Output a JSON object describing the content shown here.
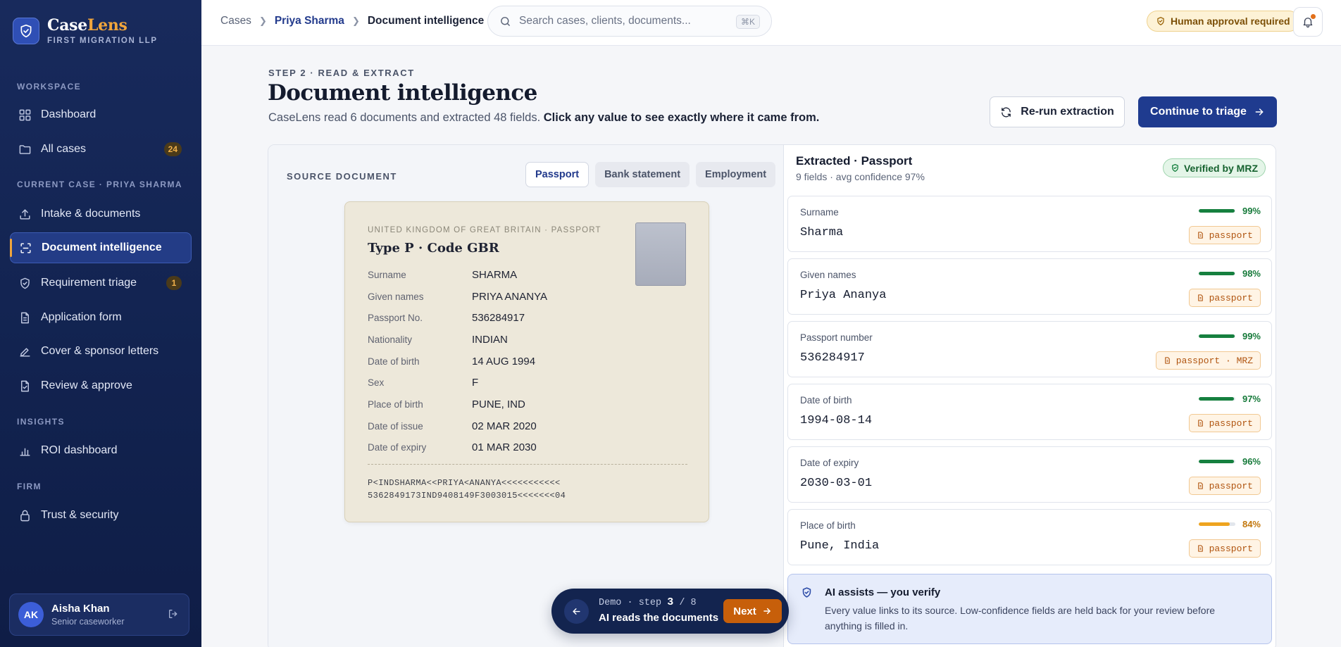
{
  "brand": {
    "name_part1": "Case",
    "name_part2": "Lens",
    "firm": "FIRST MIGRATION LLP"
  },
  "sidebar": {
    "workspace_label": "WORKSPACE",
    "workspace_items": [
      {
        "label": "Dashboard",
        "icon": "grid-icon"
      },
      {
        "label": "All cases",
        "icon": "folder-icon",
        "badge": "24"
      }
    ],
    "case_label": "CURRENT CASE · PRIYA SHARMA",
    "case_items": [
      {
        "label": "Intake & documents",
        "icon": "upload-icon"
      },
      {
        "label": "Document intelligence",
        "icon": "scan-icon",
        "active": true
      },
      {
        "label": "Requirement triage",
        "icon": "shield-check-icon",
        "badge": "1"
      },
      {
        "label": "Application form",
        "icon": "document-icon"
      },
      {
        "label": "Cover & sponsor letters",
        "icon": "pen-icon"
      },
      {
        "label": "Review & approve",
        "icon": "document-check-icon"
      }
    ],
    "insights_label": "INSIGHTS",
    "insights_items": [
      {
        "label": "ROI dashboard",
        "icon": "bar-chart-icon"
      }
    ],
    "firm_label": "FIRM",
    "firm_items": [
      {
        "label": "Trust & security",
        "icon": "lock-icon"
      }
    ],
    "user": {
      "initials": "AK",
      "name": "Aisha Khan",
      "role": "Senior caseworker"
    }
  },
  "topbar": {
    "breadcrumb": [
      "Cases",
      "Priya Sharma",
      "Document intelligence"
    ],
    "search_placeholder": "Search cases, clients, documents...",
    "search_shortcut": "⌘K",
    "approval_badge": "Human approval required"
  },
  "main": {
    "step_label": "STEP 2 · READ & EXTRACT",
    "title": "Document intelligence",
    "subtitle_plain": "CaseLens read 6 documents and extracted 48 fields. ",
    "subtitle_bold": "Click any value to see exactly where it came from.",
    "rerun_label": "Re-run extraction",
    "continue_label": "Continue to triage"
  },
  "source": {
    "label": "SOURCE DOCUMENT",
    "tabs": [
      "Passport",
      "Bank statement",
      "Employment"
    ],
    "active_tab": "Passport",
    "passport": {
      "country": "UNITED KINGDOM OF GREAT BRITAIN · PASSPORT",
      "type": "Type P · Code GBR",
      "rows": [
        {
          "k": "Surname",
          "v": "SHARMA"
        },
        {
          "k": "Given names",
          "v": "PRIYA ANANYA"
        },
        {
          "k": "Passport No.",
          "v": "536284917"
        },
        {
          "k": "Nationality",
          "v": "INDIAN"
        },
        {
          "k": "Date of birth",
          "v": "14 AUG 1994"
        },
        {
          "k": "Sex",
          "v": "F"
        },
        {
          "k": "Place of birth",
          "v": "PUNE, IND"
        },
        {
          "k": "Date of issue",
          "v": "02 MAR 2020"
        },
        {
          "k": "Date of expiry",
          "v": "01 MAR 2030"
        }
      ],
      "mrz_line1": "P<INDSHARMA<<PRIYA<ANANYA<<<<<<<<<<<",
      "mrz_line2": "5362849173IND9408149F3003015<<<<<<<04"
    }
  },
  "extracted": {
    "title": "Extracted · Passport",
    "subtitle": "9 fields · avg confidence 97%",
    "verified_label": "Verified by MRZ",
    "fields": [
      {
        "label": "Surname",
        "value": "Sharma",
        "confidence": 99,
        "confidence_label": "99%",
        "source": "passport"
      },
      {
        "label": "Given names",
        "value": "Priya Ananya",
        "confidence": 98,
        "confidence_label": "98%",
        "source": "passport"
      },
      {
        "label": "Passport number",
        "value": "536284917",
        "confidence": 99,
        "confidence_label": "99%",
        "source": "passport · MRZ"
      },
      {
        "label": "Date of birth",
        "value": "1994-08-14",
        "confidence": 97,
        "confidence_label": "97%",
        "source": "passport"
      },
      {
        "label": "Date of expiry",
        "value": "2030-03-01",
        "confidence": 96,
        "confidence_label": "96%",
        "source": "passport"
      },
      {
        "label": "Place of birth",
        "value": "Pune, India",
        "confidence": 84,
        "confidence_label": "84%",
        "source": "passport",
        "low": true
      }
    ],
    "ai_title": "AI assists — you verify",
    "ai_body": "Every value links to its source. Low-confidence fields are held back for your review before anything is filled in."
  },
  "demo": {
    "prefix": "Demo · step ",
    "current": "3",
    "total": " / 8",
    "title": "AI reads the documents",
    "next_label": "Next"
  },
  "colors": {
    "accent": "#1f3b8f",
    "brand_orange": "#f0a53c",
    "success": "#16803f",
    "warning": "#eea41f"
  }
}
